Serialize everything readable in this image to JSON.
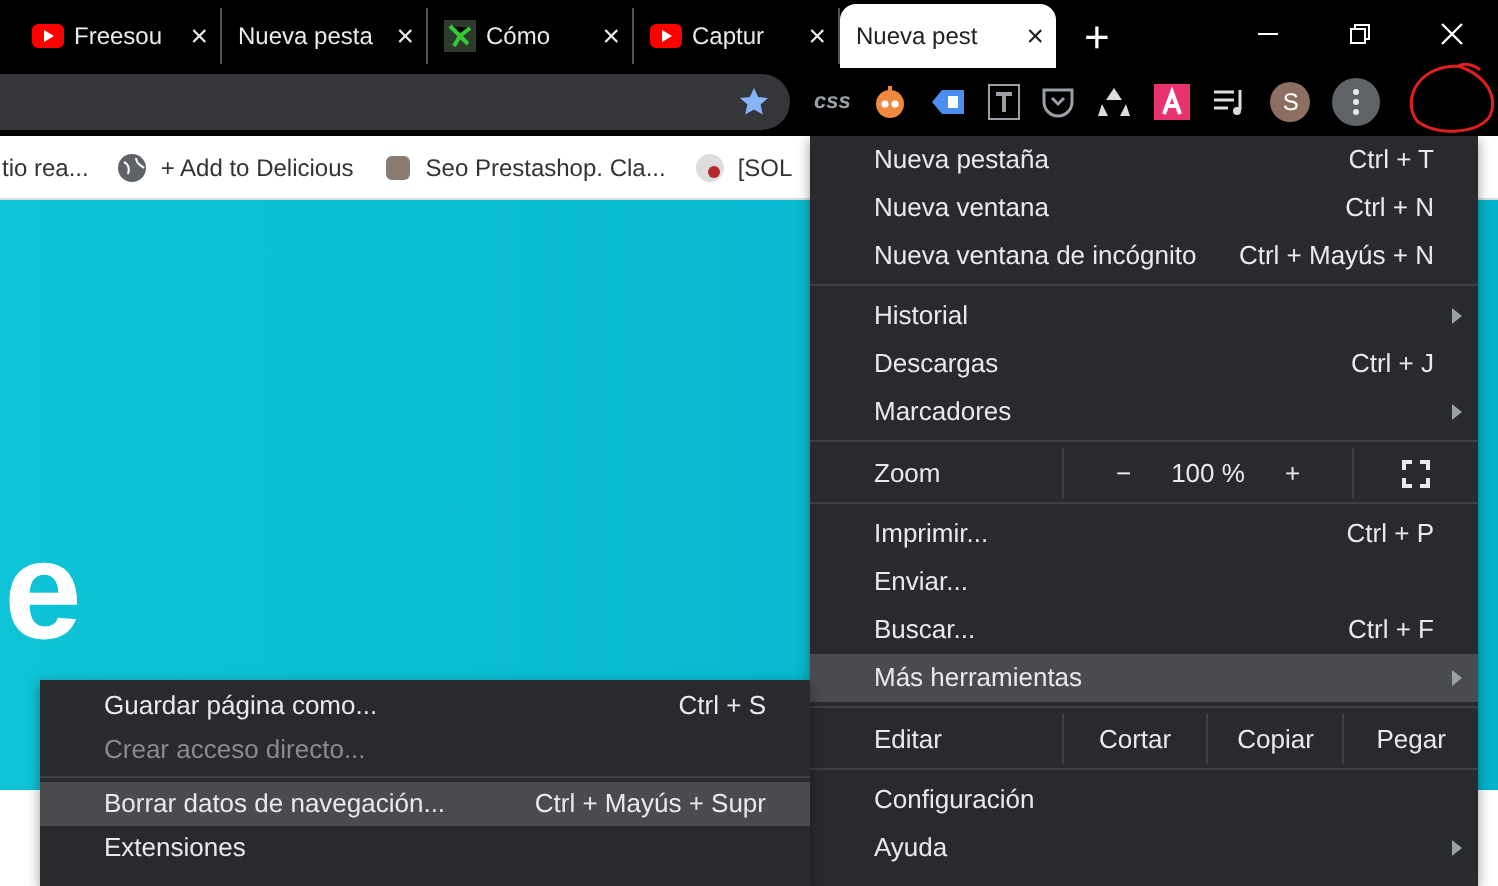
{
  "tabs": [
    {
      "label": "Freesou",
      "close": "×",
      "selected": false
    },
    {
      "label": "Nueva pesta",
      "close": "×",
      "selected": false
    },
    {
      "label": "Cómo",
      "close": "×",
      "selected": false
    },
    {
      "label": "Captur",
      "close": "×",
      "selected": false
    },
    {
      "label": "Nueva pest",
      "close": "×",
      "selected": true
    }
  ],
  "new_tab": "+",
  "toolbar": {
    "extension_text": "css",
    "avatar": "S"
  },
  "bookmarks": [
    {
      "label": "tio rea..."
    },
    {
      "label": "+ Add to Delicious"
    },
    {
      "label": "Seo Prestashop. Cla..."
    },
    {
      "label": "[SOL"
    }
  ],
  "page": {
    "heading_fragment": "e"
  },
  "main_menu": [
    {
      "kind": "item",
      "label": "Nueva pestaña",
      "shortcut": "Ctrl + T",
      "submenu": false,
      "selected": false
    },
    {
      "kind": "item",
      "label": "Nueva ventana",
      "shortcut": "Ctrl + N",
      "submenu": false,
      "selected": false
    },
    {
      "kind": "item",
      "label": "Nueva ventana de incógnito",
      "shortcut": "Ctrl + Mayús + N",
      "submenu": false,
      "selected": false
    },
    {
      "kind": "separator"
    },
    {
      "kind": "item",
      "label": "Historial",
      "submenu": true,
      "selected": false
    },
    {
      "kind": "item",
      "label": "Descargas",
      "shortcut": "Ctrl + J",
      "submenu": false,
      "selected": false
    },
    {
      "kind": "item",
      "label": "Marcadores",
      "submenu": true,
      "selected": false
    },
    {
      "kind": "separator"
    },
    {
      "kind": "zoom",
      "label": "Zoom",
      "minus": "−",
      "value": "100 %",
      "plus": "+"
    },
    {
      "kind": "separator"
    },
    {
      "kind": "item",
      "label": "Imprimir...",
      "shortcut": "Ctrl + P",
      "submenu": false,
      "selected": false
    },
    {
      "kind": "item",
      "label": "Enviar...",
      "submenu": false,
      "selected": false
    },
    {
      "kind": "item",
      "label": "Buscar...",
      "shortcut": "Ctrl + F",
      "submenu": false,
      "selected": false
    },
    {
      "kind": "item",
      "label": "Más herramientas",
      "submenu": true,
      "selected": true
    },
    {
      "kind": "separator"
    },
    {
      "kind": "edit",
      "label": "Editar",
      "actions": [
        "Cortar",
        "Copiar",
        "Pegar"
      ]
    },
    {
      "kind": "separator"
    },
    {
      "kind": "item",
      "label": "Configuración",
      "submenu": false,
      "selected": false
    },
    {
      "kind": "item",
      "label": "Ayuda",
      "submenu": true,
      "selected": false
    }
  ],
  "submenu": [
    {
      "kind": "item",
      "label": "Guardar página como...",
      "shortcut": "Ctrl + S",
      "disabled": false,
      "selected": false
    },
    {
      "kind": "item",
      "label": "Crear acceso directo...",
      "disabled": true,
      "selected": false
    },
    {
      "kind": "separator"
    },
    {
      "kind": "item",
      "label": "Borrar datos de navegación...",
      "shortcut": "Ctrl + Mayús + Supr",
      "disabled": false,
      "selected": true
    },
    {
      "kind": "item",
      "label": "Extensiones",
      "disabled": false,
      "selected": false
    }
  ]
}
